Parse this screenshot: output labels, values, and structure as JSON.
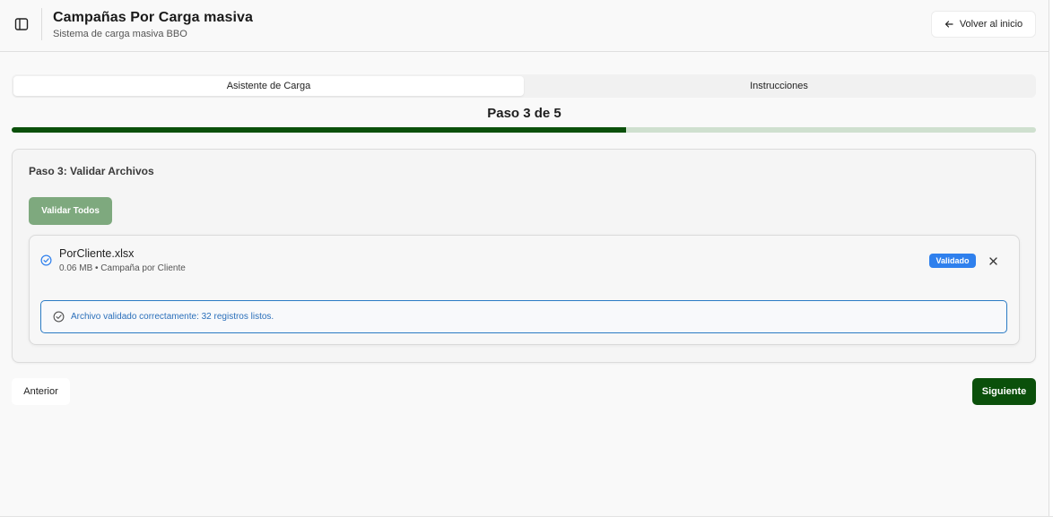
{
  "header": {
    "title": "Campañas Por Carga masiva",
    "subtitle": "Sistema de carga masiva BBO",
    "back_label": "Volver al inicio",
    "sidebar_icon": "sidebar-toggle-icon",
    "back_icon": "arrow-left-icon"
  },
  "tabs": [
    {
      "label": "Asistente de Carga",
      "active": true
    },
    {
      "label": "Instrucciones",
      "active": false
    }
  ],
  "progress": {
    "label": "Paso 3 de 5",
    "current": 3,
    "total": 5,
    "percent": 60,
    "fill_color": "#0b500b",
    "track_color": "#cfe0cf"
  },
  "card": {
    "title": "Paso 3: Validar Archivos",
    "validate_all_label": "Validar Todos",
    "file": {
      "name": "PorCliente.xlsx",
      "meta": "0.06 MB • Campaña por Cliente",
      "status": "Validado",
      "status_color": "#2f80ed",
      "status_icon": "check-circle-icon",
      "remove_icon": "close-icon",
      "alert_text": "Archivo validado correctamente: 32 registros listos.",
      "alert_icon": "check-circle-icon"
    }
  },
  "footer": {
    "prev_label": "Anterior",
    "next_label": "Siguiente",
    "primary_color": "#0b500b"
  }
}
